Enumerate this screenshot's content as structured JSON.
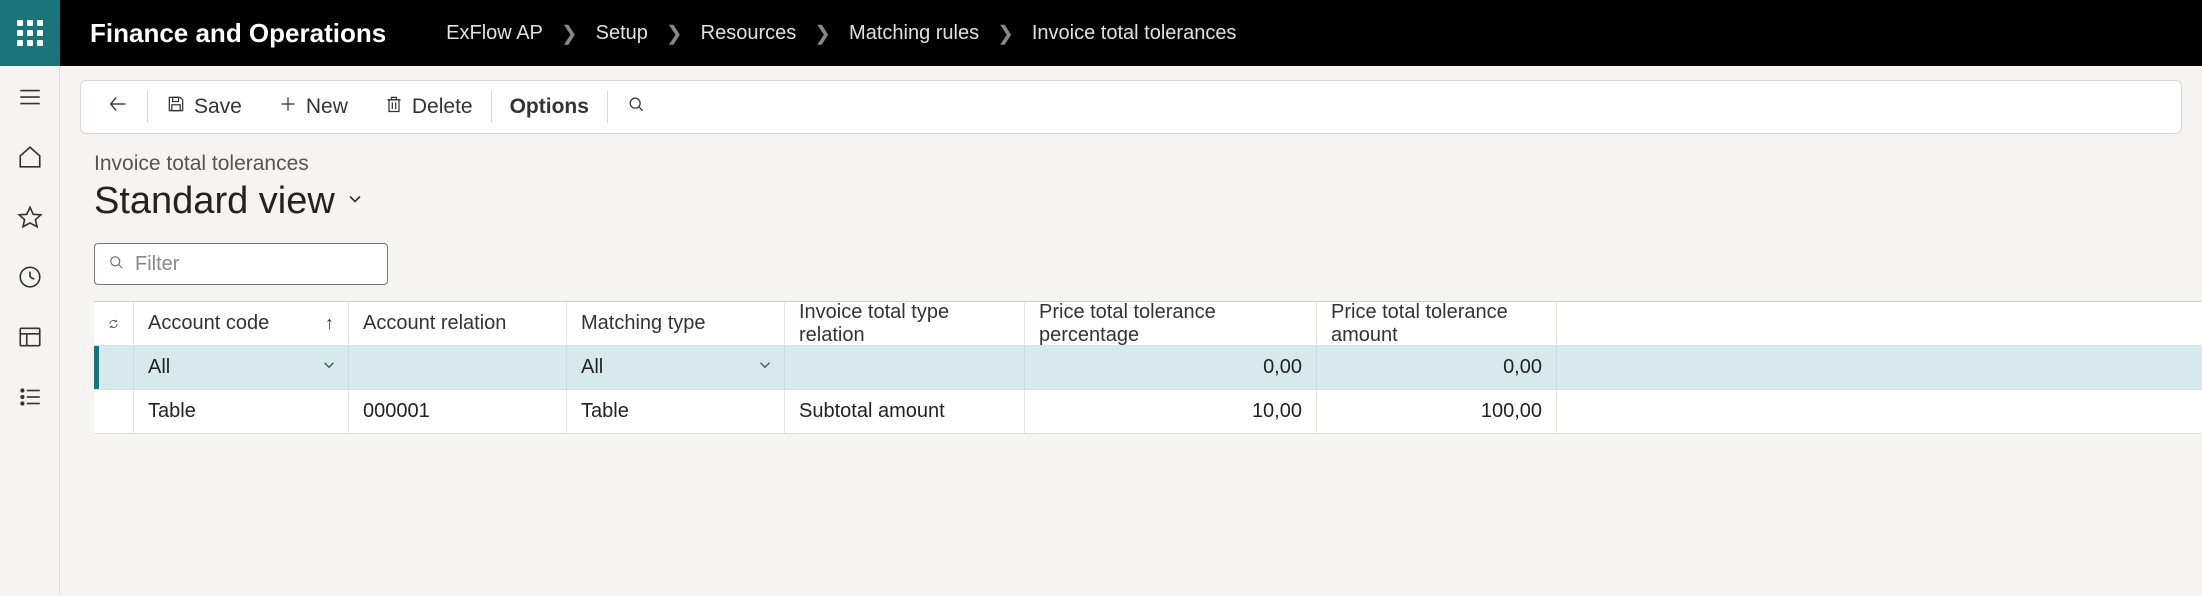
{
  "app_title": "Finance and Operations",
  "breadcrumb": [
    "ExFlow AP",
    "Setup",
    "Resources",
    "Matching rules",
    "Invoice total tolerances"
  ],
  "toolbar": {
    "save_label": "Save",
    "new_label": "New",
    "delete_label": "Delete",
    "options_label": "Options"
  },
  "page": {
    "subtitle": "Invoice total tolerances",
    "title": "Standard view"
  },
  "filter": {
    "placeholder": "Filter",
    "value": ""
  },
  "grid": {
    "headers": {
      "account_code": "Account code",
      "account_relation": "Account relation",
      "matching_type": "Matching type",
      "invoice_total_type_relation": "Invoice total type relation",
      "price_total_tolerance_percentage": "Price total tolerance percentage",
      "price_total_tolerance_amount": "Price total tolerance amount"
    },
    "rows": [
      {
        "selected": true,
        "account_code": "All",
        "account_relation": "",
        "matching_type": "All",
        "invoice_total_type_relation": "",
        "price_total_tolerance_percentage": "0,00",
        "price_total_tolerance_amount": "0,00"
      },
      {
        "selected": false,
        "account_code": "Table",
        "account_relation": "000001",
        "matching_type": "Table",
        "invoice_total_type_relation": "Subtotal amount",
        "price_total_tolerance_percentage": "10,00",
        "price_total_tolerance_amount": "100,00"
      }
    ]
  }
}
